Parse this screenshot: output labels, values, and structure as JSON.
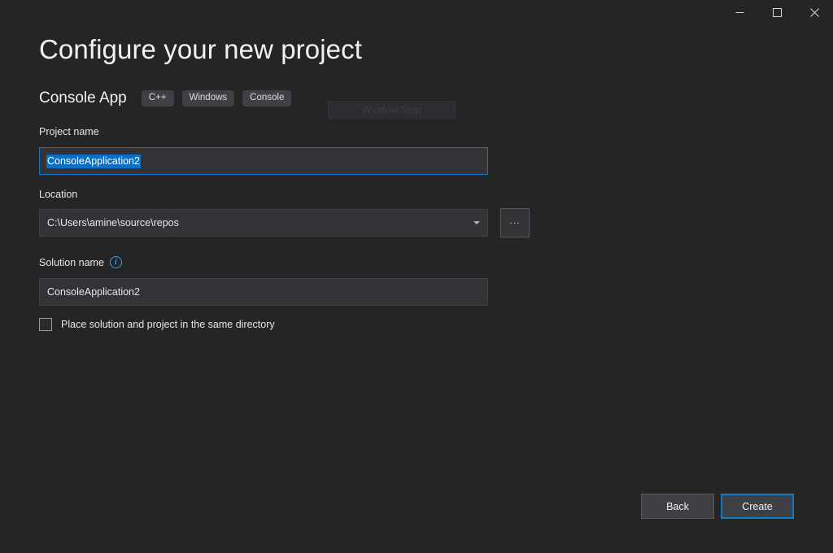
{
  "window": {
    "title": "",
    "controls": [
      {
        "name": "minimize",
        "label": "Minimize"
      },
      {
        "name": "maximize",
        "label": "Maximize"
      },
      {
        "name": "close",
        "label": "Close"
      }
    ]
  },
  "page": {
    "title": "Configure your new project"
  },
  "template": {
    "name": "Console App",
    "tags": [
      "C++",
      "Windows",
      "Console"
    ]
  },
  "overlay": {
    "snip_label": "Window Snip"
  },
  "form": {
    "project_name": {
      "label": "Project name",
      "value": "ConsoleApplication2",
      "placeholder": "Project name",
      "selected": true
    },
    "location": {
      "label": "Location",
      "value": "C:\\Users\\amine\\source\\repos",
      "placeholder": "Location",
      "browse_label": "..."
    },
    "solution_name": {
      "label": "Solution name",
      "value": "ConsoleApplication2",
      "placeholder": "Solution name",
      "info_glyph": "i"
    },
    "same_directory": {
      "label": "Place solution and project in the same directory",
      "checked": false
    }
  },
  "footer": {
    "back_label": "Back",
    "create_label": "Create"
  },
  "colors": {
    "page_background": "#252526",
    "field_background": "#333337",
    "accent_blue": "#0f79c8",
    "selection_blue": "#0c6fc4",
    "tag_background": "#3f3f46",
    "info_blue": "#4a9ad4",
    "text_primary": "#f1f1f1"
  }
}
